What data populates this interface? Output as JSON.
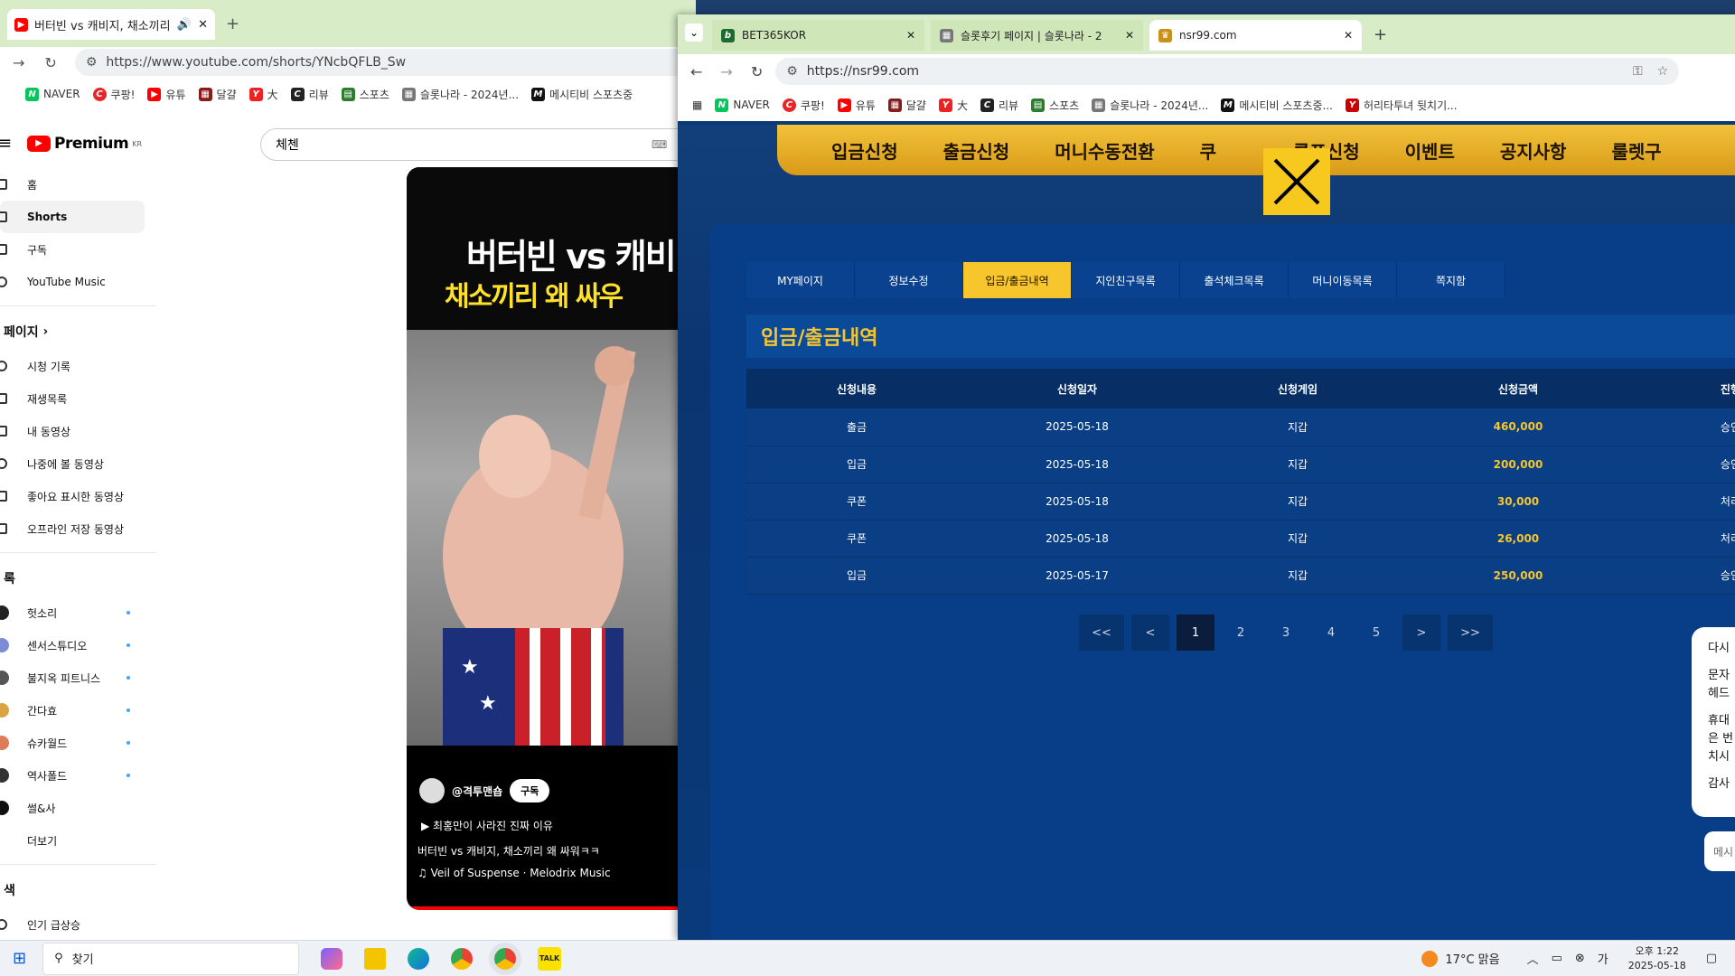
{
  "left_window": {
    "tab_title": "버터빈 vs 캐비지, 채소끼리",
    "url": "https://www.youtube.com/shorts/YNcbQFLB_Sw",
    "bookmarks": [
      "NAVER",
      "쿠팡!",
      "유튜",
      "달걀",
      "大",
      "리뷰",
      "스포츠",
      "슬롯나라 - 2024년...",
      "메시티비 스포츠중"
    ],
    "logo_text": "Premium",
    "logo_badge": "KR",
    "search_value": "체첸",
    "sidebar_top": [
      "홈",
      "Shorts",
      "구독",
      "YouTube Music"
    ],
    "section_you": "페이지",
    "sidebar_you": [
      "시청 기록",
      "재생목록",
      "내 동영상",
      "나중에 볼 동영상",
      "좋아요 표시한 동영상",
      "오프라인 저장 동영상"
    ],
    "section_subs": "록",
    "subscriptions": [
      "헛소리",
      "센서스튜디오",
      "불지옥 피트니스",
      "간다효",
      "슈카월드",
      "역사폴드",
      "썰&사",
      "더보기"
    ],
    "section_explore": "색",
    "explore": [
      "인기 급상승"
    ],
    "short_title_1": "버터빈 vs 캐비",
    "short_title_2": "채소끼리 왜 싸우",
    "channel": "@격투맨숍",
    "subscribe": "구독",
    "caption_link": "최홍만이 사라진 진짜 이유",
    "video_title": "버터빈 vs 캐비지, 채소끼리 왜 싸워ㅋㅋ",
    "music": "Veil of Suspense · Melodrix Music"
  },
  "right_window": {
    "tabs": [
      "BET365KOR",
      "슬롯후기 페이지 | 슬롯나라 - 2",
      "nsr99.com"
    ],
    "url": "https://nsr99.com",
    "bookmarks": [
      "NAVER",
      "쿠팡!",
      "유튜",
      "달걀",
      "大",
      "리뷰",
      "스포츠",
      "슬롯나라 - 2024년...",
      "메시티비 스포츠중...",
      "허리타투녀 뒷치기..."
    ],
    "nav": [
      "입금신청",
      "출금신청",
      "머니수동전환",
      "쿠",
      "콤프신청",
      "이벤트",
      "공지사항",
      "룰렛구"
    ],
    "subtabs": [
      "MY페이지",
      "정보수정",
      "입금/출금내역",
      "지인친구목록",
      "출석체크목록",
      "머니이동목록",
      "쪽지함"
    ],
    "section_title": "입금/출금내역",
    "table": {
      "headers": [
        "신청내용",
        "신청일자",
        "신청게임",
        "신청금액",
        "진행"
      ],
      "rows": [
        [
          "출금",
          "2025-05-18",
          "지갑",
          "460,000",
          "승인"
        ],
        [
          "입금",
          "2025-05-18",
          "지갑",
          "200,000",
          "승인"
        ],
        [
          "쿠폰",
          "2025-05-18",
          "지갑",
          "30,000",
          "처리"
        ],
        [
          "쿠폰",
          "2025-05-18",
          "지갑",
          "26,000",
          "처리"
        ],
        [
          "입금",
          "2025-05-17",
          "지갑",
          "250,000",
          "승인"
        ]
      ]
    },
    "pager": [
      "<<",
      "<",
      "1",
      "2",
      "3",
      "4",
      "5",
      ">",
      ">>"
    ],
    "chat_lines": [
      "다시",
      "문자",
      "헤드",
      "휴대",
      "은 번",
      "치시",
      "감사"
    ],
    "chat_input": "메시"
  },
  "taskbar": {
    "search": "찾기",
    "weather": "17°C 맑음",
    "time": "오후 1:22",
    "date": "2025-05-18"
  },
  "colors": {
    "accent": "#f7c52c",
    "site_bg": "#083d87",
    "chrome_green": "#d7ecc7"
  }
}
